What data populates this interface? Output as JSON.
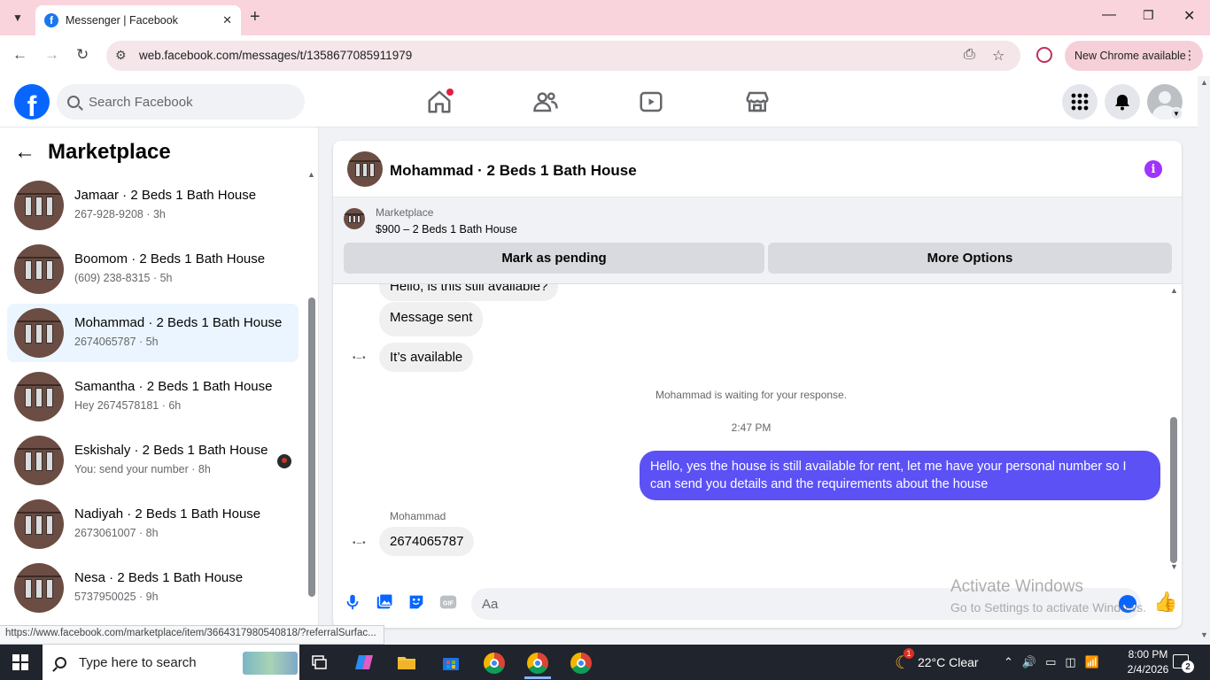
{
  "browser": {
    "tab_title": "Messenger | Facebook",
    "tab_close": "✕",
    "new_tab": "+",
    "url": "web.facebook.com/messages/t/1358677085911979",
    "new_chrome": "New Chrome available",
    "status_url": "https://www.facebook.com/marketplace/item/3664317980540818/?referralSurfac..."
  },
  "header": {
    "logo": "f",
    "search_placeholder": "Search Facebook"
  },
  "sidebar": {
    "title": "Marketplace",
    "items": [
      {
        "name": "Jamaar · 2 Beds 1 Bath House",
        "sub": "267-928-9208 · 3h"
      },
      {
        "name": "Boomom · 2 Beds 1 Bath House",
        "sub": "(609) 238-8315 · 5h"
      },
      {
        "name": "Mohammad · 2 Beds 1 Bath House",
        "sub": "2674065787 · 5h"
      },
      {
        "name": "Samantha · 2 Beds 1 Bath House",
        "sub": "Hey 2674578181 · 6h"
      },
      {
        "name": "Eskishaly · 2 Beds 1 Bath House",
        "sub": "You: send your number · 8h"
      },
      {
        "name": "Nadiyah · 2 Beds 1 Bath House",
        "sub": "2673061007 · 8h"
      },
      {
        "name": "Nesa · 2 Beds 1 Bath House",
        "sub": "5737950025 · 9h"
      }
    ]
  },
  "chat": {
    "title": "Mohammad · 2 Beds 1 Bath House",
    "marketplace_label": "Marketplace",
    "listing": "$900 – 2 Beds 1 Bath House",
    "mark_pending": "Mark as pending",
    "more_options": "More Options",
    "messages": {
      "m1": "Hello, is this still available?",
      "m2": "Message sent",
      "m3": "It’s available",
      "waiting": "Mohammad is waiting for your response.",
      "time": "2:47 PM",
      "outgoing": "Hello, yes the house is still available for rent, let me have your personal number so I can send you details and the requirements about the house",
      "sender": "Mohammad",
      "m4": "2674065787"
    },
    "input_placeholder": "Aa"
  },
  "watermark": {
    "line1": "Activate Windows",
    "line2": "Go to Settings to activate Windows."
  },
  "taskbar": {
    "search": "Type here to search",
    "weather": "22°C  Clear",
    "weather_badge": "1",
    "time": "8:00 PM",
    "date": "2/4/2026",
    "notifications": "2"
  },
  "colors": {
    "fb_blue": "#0866ff",
    "outgoing_bubble": "#5b51f5",
    "tabstrip": "#fad4dc",
    "active_item": "#ebf5ff"
  }
}
